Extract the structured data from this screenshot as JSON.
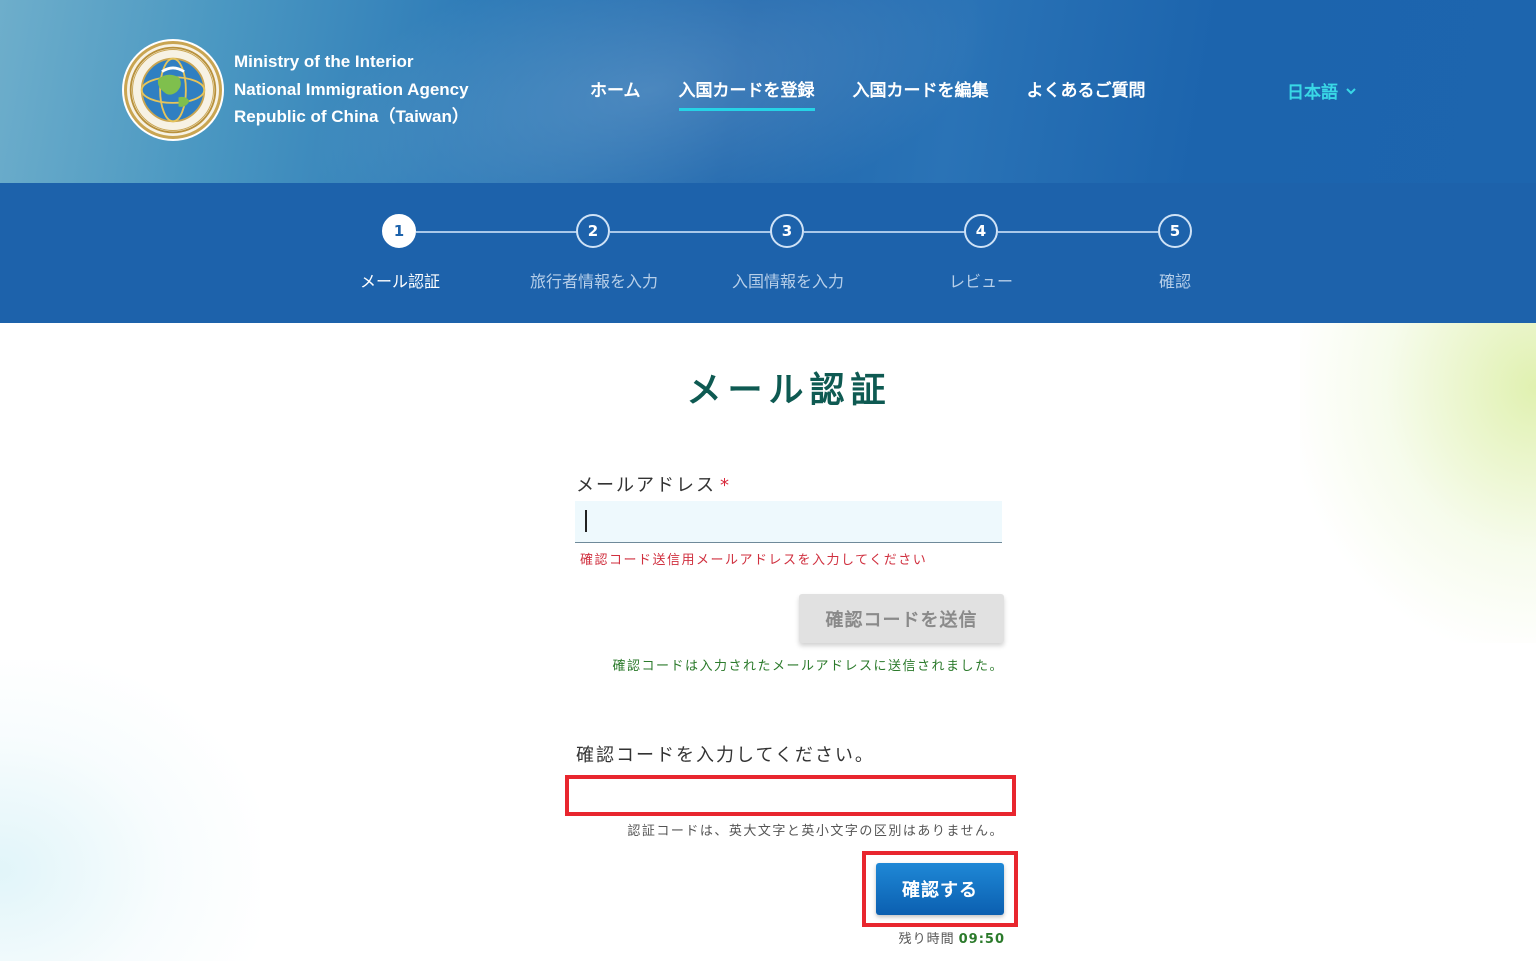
{
  "header": {
    "agency_lines": [
      "Ministry of the Interior",
      "National Immigration Agency",
      "Republic of China（Taiwan）"
    ],
    "nav": [
      {
        "label": "ホーム"
      },
      {
        "label": "入国カードを登録",
        "active": true
      },
      {
        "label": "入国カードを編集"
      },
      {
        "label": "よくあるご質問"
      }
    ],
    "language": "日本語"
  },
  "stepper": {
    "steps": [
      {
        "number": "1",
        "label": "メール認証",
        "active": true
      },
      {
        "number": "2",
        "label": "旅行者情報を入力"
      },
      {
        "number": "3",
        "label": "入国情報を入力"
      },
      {
        "number": "4",
        "label": "レビュー"
      },
      {
        "number": "5",
        "label": "確認"
      }
    ]
  },
  "form": {
    "title": "メール認証",
    "email_label": "メールアドレス",
    "required_mark": "*",
    "email_value": "",
    "email_error": "確認コード送信用メールアドレスを入力してください",
    "send_code_button": "確認コードを送信",
    "sent_message": "確認コードは入力されたメールアドレスに送信されました。",
    "code_label": "確認コードを入力してください。",
    "code_value": "",
    "case_hint": "認証コードは、英大文字と英小文字の区別はありません。",
    "confirm_button": "確認する",
    "timer_label": "残り時間",
    "timer_value": "09:50"
  },
  "colors": {
    "header_blue": "#1d62ab",
    "active_underline": "#26d3e6",
    "title_green": "#0e5a52",
    "error_red": "#d0303f",
    "success_green": "#2b7a2b",
    "highlight_red": "#e8262e",
    "confirm_blue": "#0b5fb0"
  }
}
